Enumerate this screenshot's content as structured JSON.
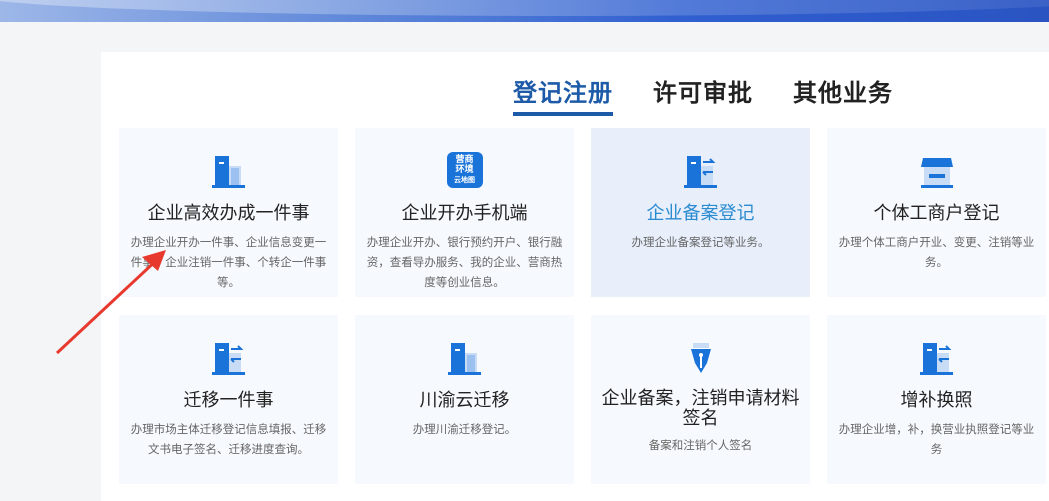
{
  "tabs": [
    {
      "label": "登记注册",
      "active": true
    },
    {
      "label": "许可审批",
      "active": false
    },
    {
      "label": "其他业务",
      "active": false
    }
  ],
  "cards": [
    {
      "title": "企业高效办成一件事",
      "desc": "办理企业开办一件事、企业信息变更一件事、企业注销一件事、个转企一件事等。",
      "icon": "building-icon"
    },
    {
      "title": "企业开办手机端",
      "desc": "办理企业开办、银行预约开户、银行融资，查看导办服务、我的企业、营商热度等创业信息。",
      "icon": "business-env-map-icon",
      "icon_text": [
        "营商",
        "环境",
        "云地图"
      ]
    },
    {
      "title": "企业备案登记",
      "desc": "办理企业备案登记等业务。",
      "icon": "building-transfer-icon"
    },
    {
      "title": "个体工商户登记",
      "desc": "办理个体工商户开业、变更、注销等业务。",
      "icon": "shop-icon"
    },
    {
      "title": "迁移一件事",
      "desc": "办理市场主体迁移登记信息填报、迁移文书电子签名、迁移进度查询。",
      "icon": "building-transfer-icon"
    },
    {
      "title": "川渝云迁移",
      "desc": "办理川渝迁移登记。",
      "icon": "building-icon"
    },
    {
      "title": "企业备案，注销申请材料签名",
      "desc": "备案和注销个人签名",
      "icon": "pen-nib-icon"
    },
    {
      "title": "增补换照",
      "desc": "办理企业增，补，换营业执照登记等业务",
      "icon": "building-transfer-icon"
    }
  ],
  "colors": {
    "accent": "#1d5aa8",
    "highlight_title": "#2a8bd0",
    "card_bg": "#f6f9fe",
    "card_highlight_bg": "#e8effb",
    "annotation_arrow": "#e8392e"
  }
}
